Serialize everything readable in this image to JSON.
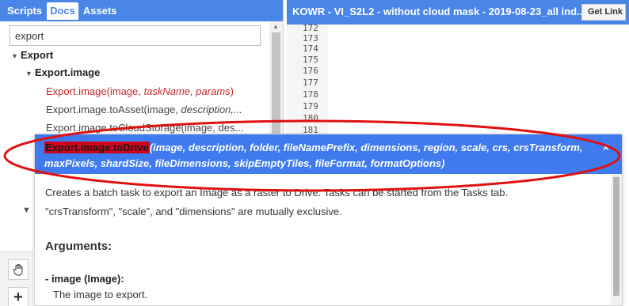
{
  "left_panel": {
    "tabs": [
      "Scripts",
      "Docs",
      "Assets"
    ],
    "active_tab": "Docs",
    "search": {
      "value": "export"
    },
    "tree": {
      "root": "Export",
      "group": "Export.image",
      "items": [
        {
          "name": "Export.image",
          "args": "(image, ",
          "args_italic": "taskName, params",
          "close": ")"
        },
        {
          "text": "Export.image.toAsset(image, ",
          "italic": "description,..."
        },
        {
          "text": "Export.image.toCloudStorage(image, des..."
        }
      ]
    }
  },
  "editor": {
    "title": "KOWR - VI_S2L2 - without cloud mask - 2019-08-23_all ind...",
    "get_link": "Get Link",
    "line_numbers": [
      "172",
      "173",
      "174",
      "175",
      "176",
      "177",
      "178",
      "179",
      "180",
      "181"
    ]
  },
  "popup": {
    "function_name": "Export.image.toDrive",
    "signature_line1": "(image, description, folder, fileNamePrefix, dimensions, region, scale, crs, crsTransform,",
    "signature_line2": "maxPixels, shardSize, fileDimensions, skipEmptyTiles, fileFormat, formatOptions)",
    "close": "×",
    "description": "Creates a batch task to export an Image as a raster to Drive. Tasks can be started from the Tasks tab.",
    "note": "\"crsTransform\", \"scale\", and \"dimensions\" are mutually exclusive.",
    "arguments_title": "Arguments:",
    "arg_name": "- image (Image):",
    "arg_desc": "The image to export."
  },
  "colors": {
    "header_blue": "#4a86e8",
    "popup_blue": "#3f7bef",
    "highlight_red": "#d0021b",
    "annotation_red": "#e01010"
  },
  "icons": [
    "hand-icon",
    "plus-icon",
    "close-icon",
    "caret-down-icon"
  ]
}
